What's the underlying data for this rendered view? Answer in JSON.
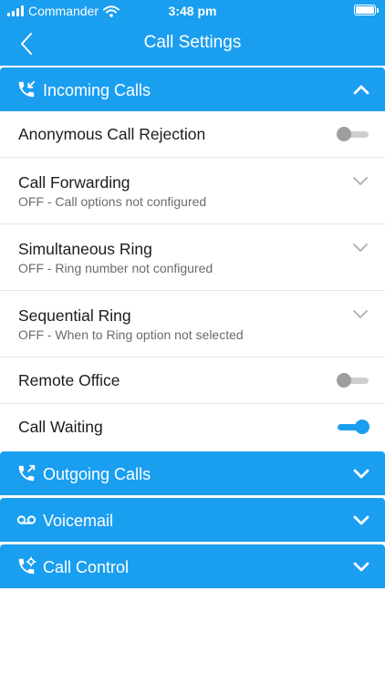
{
  "status_bar": {
    "carrier": "Commander",
    "time": "3:48 pm"
  },
  "nav": {
    "title": "Call Settings"
  },
  "sections": {
    "incoming": {
      "label": "Incoming Calls",
      "expanded": true
    },
    "outgoing": {
      "label": "Outgoing Calls",
      "expanded": false
    },
    "voicemail": {
      "label": "Voicemail",
      "expanded": false
    },
    "call_control": {
      "label": "Call Control",
      "expanded": false
    }
  },
  "incoming_items": {
    "anonymous": {
      "title": "Anonymous Call Rejection",
      "enabled": false
    },
    "forwarding": {
      "title": "Call Forwarding",
      "subtitle": "OFF - Call options not configured"
    },
    "simultaneous": {
      "title": "Simultaneous Ring",
      "subtitle": "OFF - Ring number not configured"
    },
    "sequential": {
      "title": "Sequential Ring",
      "subtitle": "OFF - When to Ring option not selected"
    },
    "remote_office": {
      "title": "Remote Office",
      "enabled": false
    },
    "call_waiting": {
      "title": "Call Waiting",
      "enabled": true
    }
  },
  "colors": {
    "accent": "#1a9ef0",
    "toggle_off_track": "#cfcfcf",
    "toggle_off_knob": "#9e9e9e",
    "chevron": "#b5b5b5"
  },
  "icons": {
    "signal": "signal-bars-icon",
    "wifi": "wifi-icon",
    "battery": "battery-icon",
    "back": "chevron-left-icon",
    "incoming": "incoming-call-icon",
    "outgoing": "outgoing-call-icon",
    "voicemail": "voicemail-icon",
    "call_control": "call-control-icon"
  }
}
